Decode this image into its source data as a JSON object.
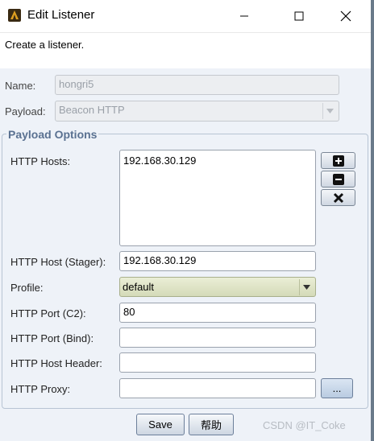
{
  "window": {
    "title": "Edit Listener",
    "description": "Create a listener."
  },
  "form": {
    "name_label": "Name:",
    "name_value": "hongri5",
    "payload_label": "Payload:",
    "payload_value": "Beacon HTTP"
  },
  "payload_options": {
    "group_title": "Payload Options",
    "http_hosts_label": "HTTP Hosts:",
    "http_hosts": [
      "192.168.30.129"
    ],
    "stager_label": "HTTP Host (Stager):",
    "stager_value": "192.168.30.129",
    "profile_label": "Profile:",
    "profile_value": "default",
    "port_c2_label": "HTTP Port (C2):",
    "port_c2_value": "80",
    "port_bind_label": "HTTP Port (Bind):",
    "port_bind_value": "",
    "host_header_label": "HTTP Host Header:",
    "host_header_value": "",
    "proxy_label": "HTTP Proxy:",
    "proxy_value": "",
    "proxy_button_label": "..."
  },
  "buttons": {
    "save": "Save",
    "help": "帮助"
  },
  "watermark": "CSDN @IT_Coke",
  "icons": {
    "add": "plus-icon",
    "remove": "minus-icon",
    "clear": "x-icon"
  }
}
